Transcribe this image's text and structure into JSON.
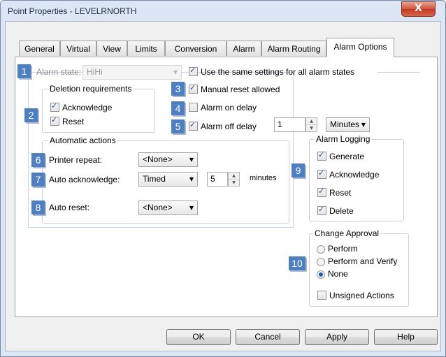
{
  "window": {
    "title": "Point Properties - LEVELRNORTH",
    "close_glyph": "X"
  },
  "tabs": [
    "General",
    "Virtual",
    "View",
    "Limits",
    "Conversion",
    "Alarm",
    "Alarm Routing",
    "Alarm Options"
  ],
  "badges": [
    "1",
    "2",
    "3",
    "4",
    "5",
    "6",
    "7",
    "8",
    "9",
    "10"
  ],
  "alarm_state": {
    "label": "Alarm state:",
    "value": "HiHi"
  },
  "deletion": {
    "legend": "Deletion requirements",
    "acknowledge": {
      "label": "Acknowledge",
      "checked": true
    },
    "reset": {
      "label": "Reset",
      "checked": true
    }
  },
  "same_settings": {
    "label": "Use the same settings for all alarm states",
    "checked": true
  },
  "manual_reset": {
    "label": "Manual reset allowed",
    "checked": true
  },
  "alarm_on_delay": {
    "label": "Alarm on delay",
    "checked": false
  },
  "alarm_off_delay": {
    "label": "Alarm off delay",
    "checked": true,
    "value": "1",
    "unit": "Minutes"
  },
  "automatic": {
    "legend": "Automatic actions",
    "printer_repeat": {
      "label": "Printer repeat:",
      "value": "<None>"
    },
    "auto_ack": {
      "label": "Auto acknowledge:",
      "value": "Timed",
      "minutes_value": "5",
      "minutes_label": "minutes"
    },
    "auto_reset": {
      "label": "Auto reset:",
      "value": "<None>"
    }
  },
  "logging": {
    "legend": "Alarm Logging",
    "generate": {
      "label": "Generate",
      "checked": true
    },
    "acknowledge": {
      "label": "Acknowledge",
      "checked": true
    },
    "reset": {
      "label": "Reset",
      "checked": true
    },
    "delete": {
      "label": "Delete",
      "checked": true
    }
  },
  "approval": {
    "legend": "Change Approval",
    "perform": {
      "label": "Perform",
      "selected": false
    },
    "perform_verify": {
      "label": "Perform and Verify",
      "selected": false
    },
    "none": {
      "label": "None",
      "selected": true
    },
    "unsigned": {
      "label": "Unsigned Actions",
      "checked": false
    }
  },
  "buttons": {
    "ok": "OK",
    "cancel": "Cancel",
    "apply": "Apply",
    "help": "Help"
  },
  "colors": {
    "badge": "#4d7fc1",
    "close": "#c23a22",
    "frame": "#dce6f4"
  }
}
